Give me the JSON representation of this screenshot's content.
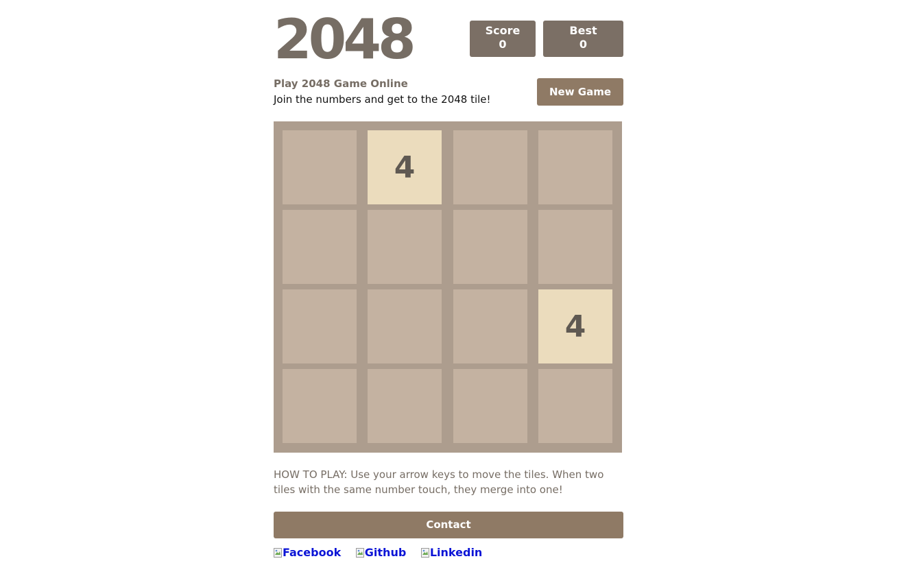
{
  "header": {
    "title": "2048",
    "score_label": "Score",
    "score_value": "0",
    "best_label": "Best",
    "best_value": "0"
  },
  "intro": {
    "subtitle": "Play 2048 Game Online",
    "tagline": "Join the numbers and get to the 2048 tile!",
    "new_game_label": "New Game"
  },
  "board": {
    "size": 4,
    "grid": [
      [
        "",
        "4",
        "",
        ""
      ],
      [
        "",
        "",
        "",
        ""
      ],
      [
        "",
        "",
        "",
        "4"
      ],
      [
        "",
        "",
        "",
        ""
      ]
    ]
  },
  "footer": {
    "how_to_play": "HOW TO PLAY: Use your arrow keys to move the tiles. When two tiles with the same number touch, they merge into one!",
    "contact_label": "Contact",
    "social_links": [
      "Facebook",
      "Github",
      "Linkedin"
    ]
  },
  "colors": {
    "board_bg": "#ad9d8e",
    "empty_cell": "#c4b2a1",
    "tile_4": "#ebdcbd",
    "score_box": "#7b6f65",
    "button": "#8f7a65",
    "title_text": "#766d64",
    "link": "#0b14d6"
  }
}
